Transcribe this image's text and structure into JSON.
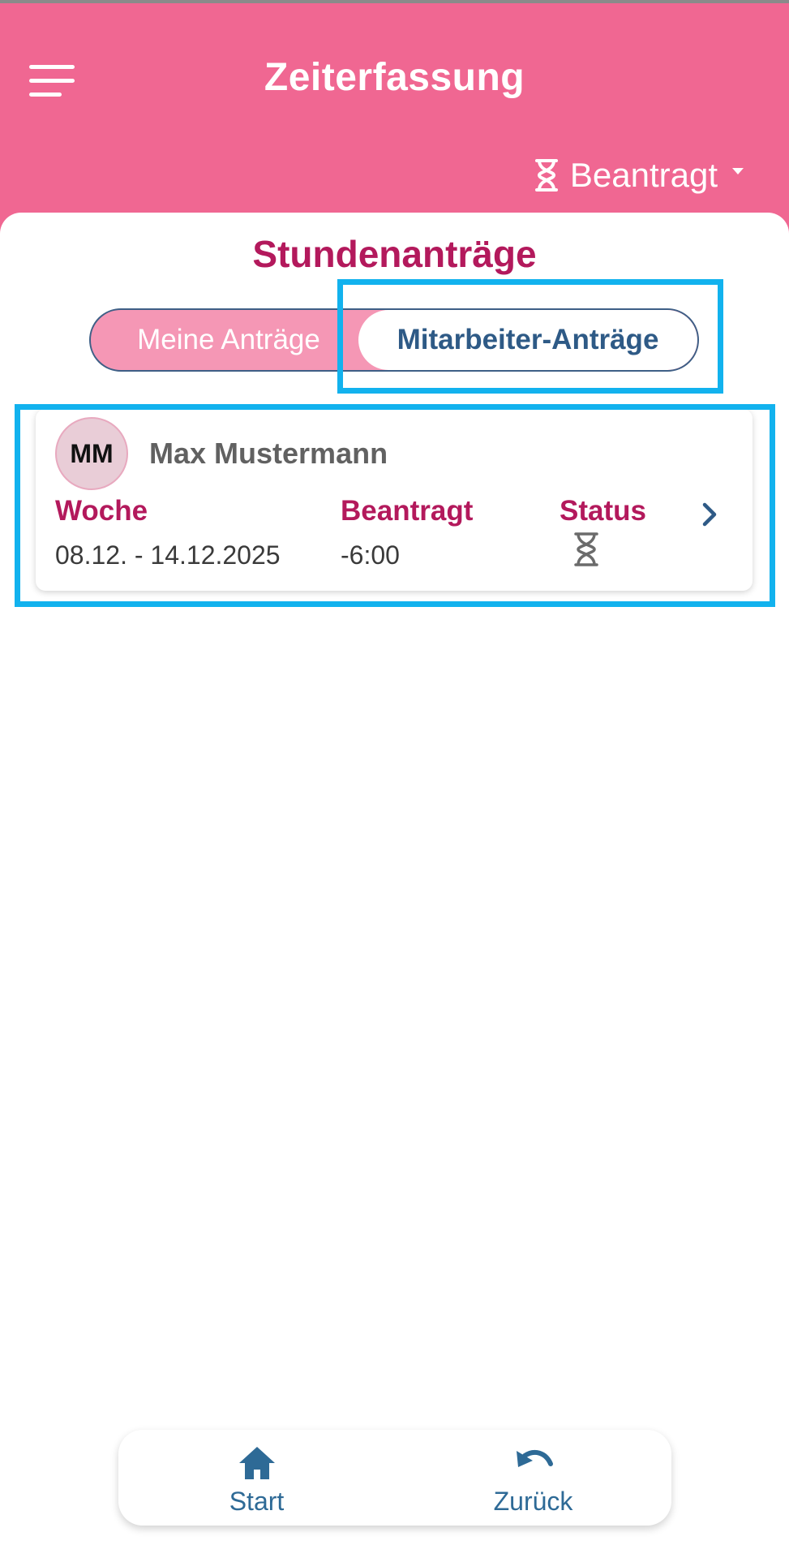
{
  "header": {
    "title": "Zeiterfassung",
    "status_filter": {
      "label": "Beantragt",
      "icon": "hourglass-icon"
    },
    "menu_icon": "menu-icon"
  },
  "main": {
    "title": "Stundenanträge",
    "tabs": [
      {
        "label": "Meine Anträge",
        "selected": false
      },
      {
        "label": "Mitarbeiter-Anträge",
        "selected": true
      }
    ],
    "requests": [
      {
        "initials": "MM",
        "name": "Max Mustermann",
        "week_label": "Woche",
        "week_value": "08.12. - 14.12.2025",
        "requested_label": "Beantragt",
        "requested_value": "-6:00",
        "status_label": "Status",
        "status_icon": "hourglass-icon"
      }
    ]
  },
  "bottom_nav": {
    "items": [
      {
        "label": "Start",
        "icon": "home-icon"
      },
      {
        "label": "Zurück",
        "icon": "undo-icon"
      }
    ]
  },
  "colors": {
    "header": "#f06792",
    "accent": "#b3195c",
    "link": "#2e5a86",
    "highlight": "#12b2ee"
  }
}
